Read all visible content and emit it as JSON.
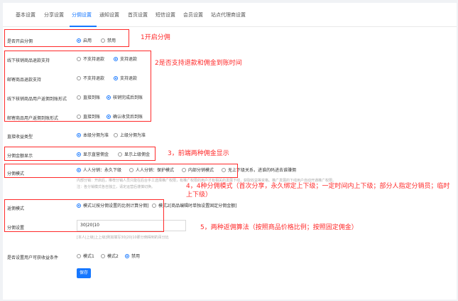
{
  "tabs": [
    "基本设置",
    "分享设置",
    "分佣设置",
    "通知设置",
    "首页设置",
    "短信设置",
    "会员设置",
    "站点代理商设置"
  ],
  "active_tab": 2,
  "rows": {
    "enable": {
      "label": "是否开启分佣",
      "options": [
        "启用",
        "禁用"
      ],
      "selected": 0
    },
    "offline_refund": {
      "label": "线下核销商品退款支持",
      "options": [
        "不支持退款",
        "支持退款"
      ],
      "selected": 1
    },
    "mail_refund": {
      "label": "邮寄商品退款支持",
      "options": [
        "不支持退款",
        "支持退款"
      ],
      "selected": 1
    },
    "offline_arrival": {
      "label": "线下核销商品用户返佣到账形式",
      "options": [
        "直接到账",
        "核销完成后到账"
      ],
      "selected": 1
    },
    "mail_arrival": {
      "label": "邮寄商品用户返佣到账形式",
      "options": [
        "直接到账",
        "确认收货后到账"
      ],
      "selected": 1
    },
    "income_type": {
      "label": "直接收益类型",
      "options": [
        "本级分佣为准",
        "上级分佣为准"
      ],
      "selected": 0
    },
    "display": {
      "label": "分佣金额显示",
      "options": [
        "显示直营佣金",
        "显示上级佣金"
      ],
      "selected": 0
    },
    "mode": {
      "label": "分佣模式",
      "options": [
        "人人分销：永久下级",
        "人人分销：保护模式",
        "内部分销模式",
        "无上下级关系，进谁的码进去谁赚佣"
      ],
      "selected": 0,
      "note1": "内部分销：开启后，推荐分销人员只能在后台手工选择推广权限，有推广权限的用户才有相关的发展下线，获取收益等资格。推广发展的下线用户自动开通推广权限。",
      "note2": "注：各分销模式各自独立，请定运营后谨慎切换。"
    },
    "rebate": {
      "label": "返佣模式",
      "options": [
        "模式1[按分佣设置的比例计算分佣]",
        "模式2[商品编辑时单独设置固定分佣金额]"
      ],
      "selected": 0
    },
    "setting": {
      "label": "分佣设置",
      "value": "30|20|10",
      "hint": "[本人|上级|上上级]例如填写30|20|10那分佣得到的百分比"
    },
    "condition": {
      "label": "是否设置用户可获收益条件",
      "options": [
        "模式1",
        "模式2",
        "禁用"
      ],
      "selected": 2
    }
  },
  "save_label": "保存",
  "annotations": {
    "a1": "1开启分佣",
    "a2": "2是否支持退款和佣金到账时间",
    "a3": "3，前端两种佣金显示",
    "a4": "4，4种分佣模式（首次分享，永久绑定上下级；一定时间内上下级；部分人指定分销员；临时上下级）",
    "a5": "5，两种返佣算法（按照商品价格比例；按照固定佣金）"
  }
}
